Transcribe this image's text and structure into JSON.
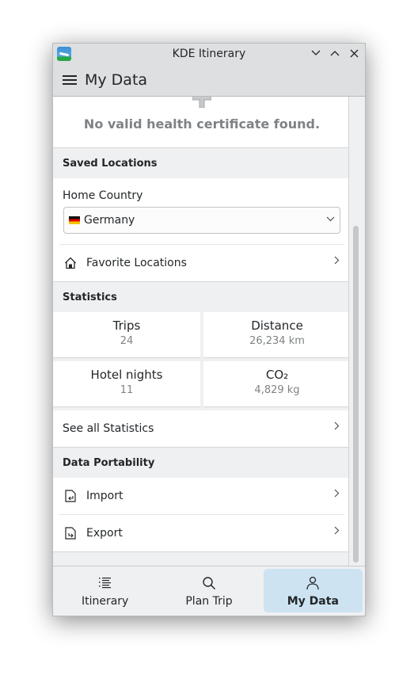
{
  "window": {
    "title": "KDE Itinerary",
    "controls": [
      "minimize",
      "maximize",
      "close"
    ]
  },
  "header": {
    "title": "My Data",
    "menu_icon": "hamburger-icon"
  },
  "health": {
    "message": "No valid health certificate found."
  },
  "saved_locations": {
    "heading": "Saved Locations",
    "home_country_label": "Home Country",
    "home_country_value": "Germany",
    "home_country_flag": "flag-de",
    "favorite_label": "Favorite Locations"
  },
  "statistics": {
    "heading": "Statistics",
    "items": [
      {
        "label": "Trips",
        "value": "24"
      },
      {
        "label": "Distance",
        "value": "26,234 km"
      },
      {
        "label": "Hotel nights",
        "value": "11"
      },
      {
        "label": "CO₂",
        "value": "4,829 kg"
      }
    ],
    "see_all_label": "See all Statistics"
  },
  "portability": {
    "heading": "Data Portability",
    "import_label": "Import",
    "export_label": "Export"
  },
  "nav": {
    "tabs": [
      {
        "label": "Itinerary",
        "icon": "itinerary-list-icon",
        "active": false
      },
      {
        "label": "Plan Trip",
        "icon": "search-icon",
        "active": false
      },
      {
        "label": "My Data",
        "icon": "user-icon",
        "active": true
      }
    ]
  },
  "colors": {
    "active_tab": "#cde3f2",
    "window_bg": "#eff0f1",
    "muted_text": "#7f8285"
  }
}
